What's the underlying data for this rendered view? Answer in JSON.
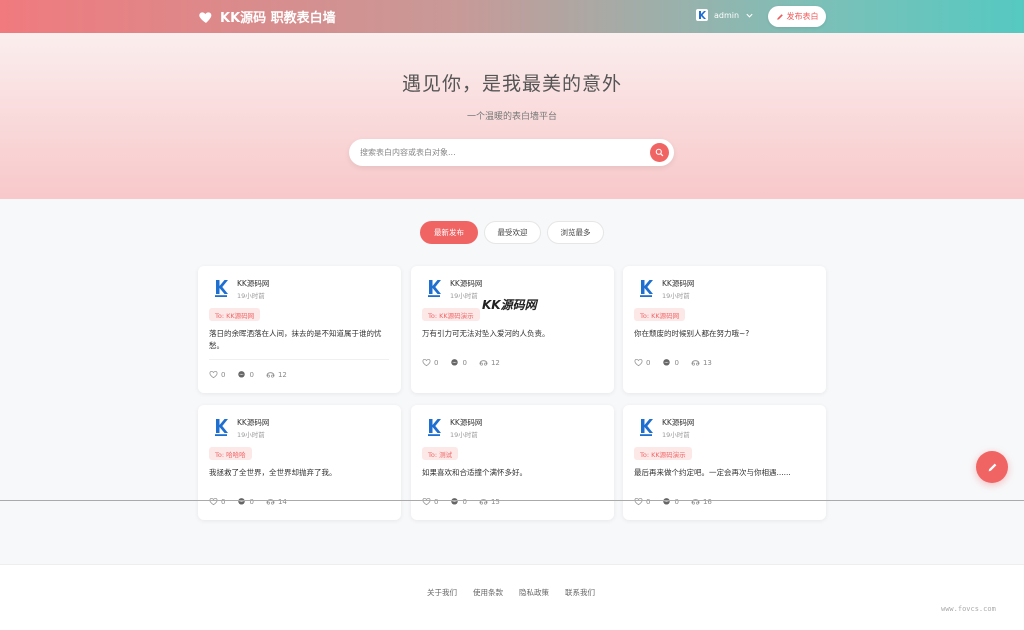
{
  "header": {
    "brand": "KK源码 职教表白墙",
    "user": "admin",
    "publish_label": "发布表白"
  },
  "hero": {
    "title": "遇见你，是我最美的意外",
    "subtitle": "一个温暖的表白墙平台",
    "search_placeholder": "搜索表白内容或表白对象..."
  },
  "tabs": [
    {
      "label": "最新发布",
      "active": true
    },
    {
      "label": "最受欢迎",
      "active": false
    },
    {
      "label": "浏览最多",
      "active": false
    }
  ],
  "watermark": "KK源码网",
  "cards": [
    {
      "author": "KK源码网",
      "time": "19小时前",
      "to": "To: KK源码网",
      "content": "落日的余晖洒落在人间，抹去的是不知道属于谁的忧愁。",
      "likes": "0",
      "comments": "0",
      "views": "12"
    },
    {
      "author": "KK源码网",
      "time": "19小时前",
      "to": "To: KK源码演示",
      "content": "万有引力可无法对坠入爱河的人负责。",
      "likes": "0",
      "comments": "0",
      "views": "12"
    },
    {
      "author": "KK源码网",
      "time": "19小时前",
      "to": "To: KK源码网",
      "content": "你在颓废的时候别人都在努力哦~?",
      "likes": "0",
      "comments": "0",
      "views": "13"
    },
    {
      "author": "KK源码网",
      "time": "19小时前",
      "to": "To: 哈哈哈",
      "content": "我拯救了全世界，全世界却抛弃了我。",
      "likes": "0",
      "comments": "0",
      "views": "14"
    },
    {
      "author": "KK源码网",
      "time": "19小时前",
      "to": "To: 测试",
      "content": "如果喜欢和合适撞个满怀多好。",
      "likes": "0",
      "comments": "0",
      "views": "15"
    },
    {
      "author": "KK源码网",
      "time": "19小时前",
      "to": "To: KK源码演示",
      "content": "最后再来做个约定吧。一定会再次与你相遇......",
      "likes": "0",
      "comments": "0",
      "views": "16"
    }
  ],
  "footer": {
    "links": [
      "关于我们",
      "使用条款",
      "隐私政策",
      "联系我们"
    ],
    "site": "www.fovcs.com"
  }
}
